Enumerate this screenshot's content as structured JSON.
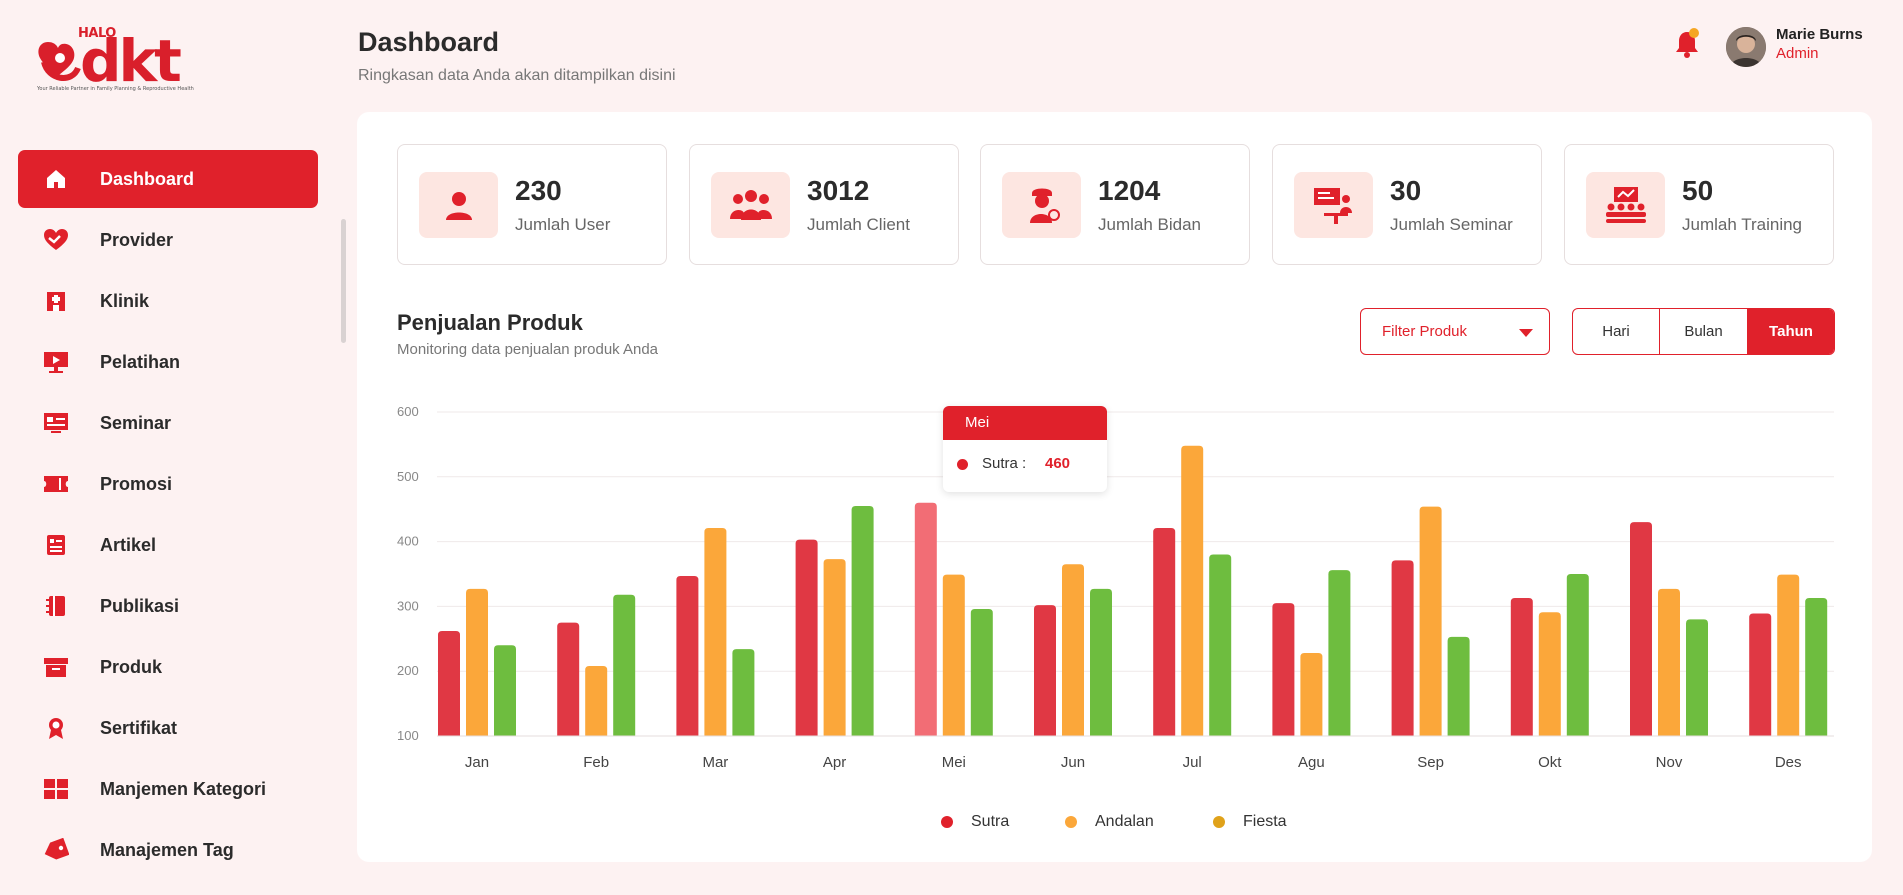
{
  "sidebar": {
    "logo": {
      "halo": "HALO",
      "brand": "dkt",
      "tagline": "Your Reliable Partner in Family Planning & Reproductive Health"
    },
    "items": [
      {
        "label": "Dashboard",
        "icon": "home-icon",
        "active": true
      },
      {
        "label": "Provider",
        "icon": "heart-handshake-icon"
      },
      {
        "label": "Klinik",
        "icon": "clinic-icon"
      },
      {
        "label": "Pelatihan",
        "icon": "training-board-icon"
      },
      {
        "label": "Seminar",
        "icon": "seminar-screen-icon"
      },
      {
        "label": "Promosi",
        "icon": "ticket-icon"
      },
      {
        "label": "Artikel",
        "icon": "article-icon"
      },
      {
        "label": "Publikasi",
        "icon": "book-icon"
      },
      {
        "label": "Produk",
        "icon": "box-icon"
      },
      {
        "label": "Sertifikat",
        "icon": "award-icon"
      },
      {
        "label": "Manjemen Kategori",
        "icon": "grid-icon"
      },
      {
        "label": "Manajemen Tag",
        "icon": "tag-icon"
      }
    ]
  },
  "header": {
    "title": "Dashboard",
    "subtitle": "Ringkasan data Anda akan ditampilkan disini",
    "user": {
      "name": "Marie Burns",
      "role": "Admin"
    }
  },
  "stats": [
    {
      "value": "230",
      "label": "Jumlah User",
      "icon": "user-icon"
    },
    {
      "value": "3012",
      "label": "Jumlah Client",
      "icon": "users-group-icon"
    },
    {
      "value": "1204",
      "label": "Jumlah Bidan",
      "icon": "midwife-icon"
    },
    {
      "value": "30",
      "label": "Jumlah Seminar",
      "icon": "presentation-icon"
    },
    {
      "value": "50",
      "label": "Jumlah Training",
      "icon": "training-icon"
    }
  ],
  "sales": {
    "title": "Penjualan Produk",
    "subtitle": "Monitoring data penjualan produk Anda",
    "filter_label": "Filter Produk",
    "periods": [
      "Hari",
      "Bulan",
      "Tahun"
    ],
    "active_period": "Tahun",
    "tooltip": {
      "month": "Mei",
      "series": "Sutra :",
      "value": "460"
    }
  },
  "colors": {
    "accent": "#e0212b",
    "sutra": "#e03844",
    "sutra_highlight": "#f26d75",
    "andalan": "#fba73a",
    "fiesta": "#6ebd3f",
    "fiesta_legend": "#e0a21a"
  },
  "chart_data": {
    "type": "bar",
    "categories": [
      "Jan",
      "Feb",
      "Mar",
      "Apr",
      "Mei",
      "Jun",
      "Jul",
      "Agu",
      "Sep",
      "Okt",
      "Nov",
      "Des"
    ],
    "series": [
      {
        "name": "Sutra",
        "values": [
          262,
          275,
          347,
          403,
          460,
          302,
          421,
          305,
          371,
          313,
          430,
          289
        ]
      },
      {
        "name": "Andalan",
        "values": [
          327,
          208,
          421,
          373,
          349,
          365,
          548,
          228,
          454,
          291,
          327,
          349
        ]
      },
      {
        "name": "Fiesta",
        "values": [
          240,
          318,
          234,
          455,
          296,
          327,
          380,
          356,
          253,
          350,
          280,
          313
        ]
      }
    ],
    "ylim": [
      100,
      600
    ],
    "yticks": [
      "100",
      "200",
      "300",
      "400",
      "500",
      "600"
    ],
    "grid": true,
    "legend_position": "bottom-center"
  }
}
